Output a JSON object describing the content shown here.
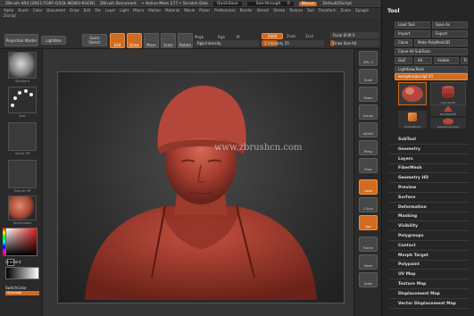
{
  "titlebar": {
    "app": "ZBrush 4R4 [2RE1-TG9F-Q5QL-NDW3-6GEN]",
    "doc": "ZBrush Document",
    "mem": "• Active Mem 277 • Scratch Disk",
    "quicksave": "QuickSave",
    "seethrough": "See-through",
    "seethrough_val": "0",
    "menus_btn": "Menus",
    "script": "DefaultZScript"
  },
  "menubar": [
    "Alpha",
    "Brush",
    "Color",
    "Document",
    "Draw",
    "Edit",
    "File",
    "Layer",
    "Light",
    "Macro",
    "Marker",
    "Material",
    "Movie",
    "Picker",
    "Preferences",
    "Render",
    "Stencil",
    "Stroke",
    "Texture",
    "Tool",
    "Transform",
    "Zoom",
    "Zplugin",
    "Zscript"
  ],
  "shelf": {
    "projection_master": "Projection Master",
    "lightbox": "LightBox",
    "quick_sketch": "Quick Sketch",
    "edit": "Edit",
    "draw": "Draw",
    "move": "Move",
    "scale": "Scale",
    "rotate": "Rotate",
    "mrgb": "Mrgb",
    "rgb": "Rgb",
    "m": "M",
    "zadd": "Zadd",
    "zsub": "Zsub",
    "zcut": "Zcut",
    "rgb_intensity": "Rgb Intensity",
    "z_intensity": "Z Intensity 25",
    "focal_shift": "Focal Shift 0",
    "draw_size": "Draw Size 64",
    "dynamic": "Dynamic"
  },
  "left_tray": {
    "brush_caption": "Standard",
    "stroke_caption": "Dots",
    "alpha_caption": "Alpha Off",
    "texture_caption": "Texture Off",
    "material_caption": "SkinShade4",
    "gradient": "Gradient",
    "switch_color": "SwitchColor",
    "alternate": "Alternate"
  },
  "canvas": {
    "watermark": "www.zbrushcn.com"
  },
  "right_icons": [
    {
      "label": "SPix 3",
      "accent": false
    },
    {
      "label": "Scroll",
      "accent": false
    },
    {
      "label": "Zoom",
      "accent": false
    },
    {
      "label": "Actual",
      "accent": false
    },
    {
      "label": "AAHalf",
      "accent": false
    },
    {
      "label": "Persp",
      "accent": false
    },
    {
      "label": "Floor",
      "accent": false
    },
    {
      "label": "Local",
      "accent": true
    },
    {
      "label": "L.Sym",
      "accent": false
    },
    {
      "label": "Xyz",
      "accent": true
    },
    {
      "label": "Frame",
      "accent": false
    },
    {
      "label": "Move",
      "accent": false
    },
    {
      "label": "Scale",
      "accent": false
    }
  ],
  "tool": {
    "title": "Tool",
    "load_tool": "Load Tool",
    "save_as": "Save As",
    "import": "Import",
    "export": "Export",
    "clone": "Clone",
    "make_polymesh": "Make PolyMesh3D",
    "clone_all": "Clone All SubTools",
    "goz": "GoZ",
    "all": "All",
    "visible": "Visible",
    "r": "R",
    "lightbox_tools": "Lightbox▸Tools",
    "current_tool": "wangdongsculpt 41",
    "thumbs": [
      "Cylinder3D",
      "PolyMesh3D",
      "SimpleBrush",
      "wangdongsculpt"
    ],
    "items": [
      "SubTool",
      "Geometry",
      "Layers",
      "FiberMesh",
      "Geometry HD",
      "Preview",
      "Surface",
      "Deformation",
      "Masking",
      "Visibility",
      "Polygroups",
      "Contact",
      "Morph Target",
      "Polypaint",
      "UV Map",
      "Texture Map",
      "Displacement Map",
      "Vector Displacement Map"
    ]
  },
  "colors": {
    "accent": "#d06b1f",
    "sculpt_red": "#b5473a"
  }
}
